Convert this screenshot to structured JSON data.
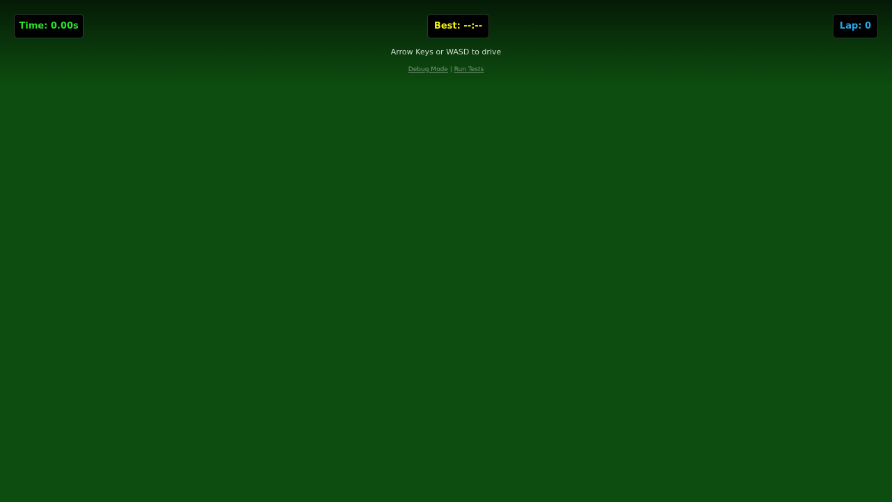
{
  "hud": {
    "time": "Time: 0.00s",
    "best": "Best: --:--",
    "lap": "Lap: 0"
  },
  "instructions": "Arrow Keys or WASD to drive",
  "links": {
    "debug": "Debug Mode",
    "separator": "|",
    "tests": "Run Tests"
  },
  "colors": {
    "background": "#0d4d0f",
    "time": "#27e32b",
    "best": "#f2f21a",
    "lap": "#27a8e8"
  }
}
